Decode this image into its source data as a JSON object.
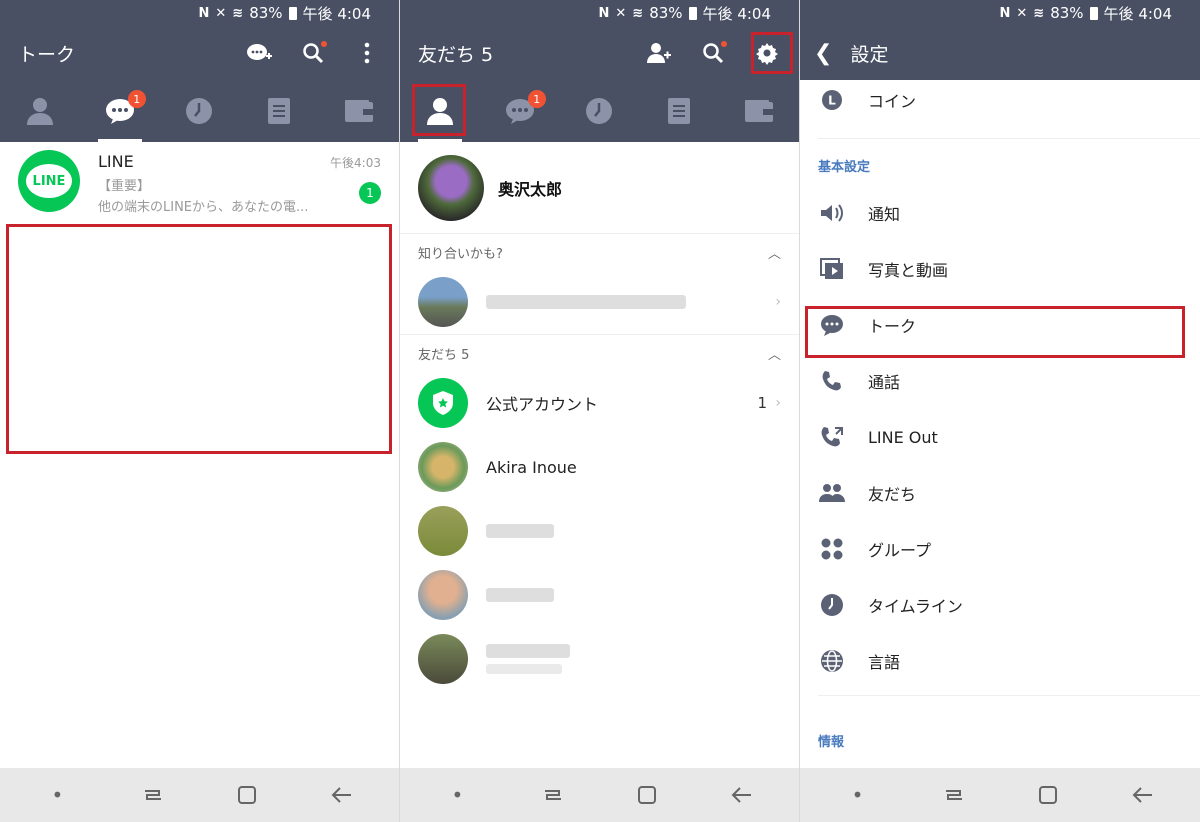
{
  "status": {
    "battery": "83%",
    "time": "午後 4:04"
  },
  "screen1": {
    "title": "トーク",
    "chat": {
      "name": "LINE",
      "time": "午後4:03",
      "line1": "【重要】",
      "line2": "他の端末のLINEから、あなたの電...",
      "count": "1",
      "logo_text": "LINE"
    },
    "tab_badge": "1"
  },
  "screen2": {
    "title": "友だち 5",
    "profile_name": "奥沢太郎",
    "section_suggest": "知り合いかも?",
    "section_friends": "友だち 5",
    "official": {
      "name": "公式アカウント",
      "count": "1"
    },
    "friend_akira": "Akira Inoue",
    "tab_badge": "1"
  },
  "screen3": {
    "title": "設定",
    "coin": "コイン",
    "section_basic": "基本設定",
    "items": [
      "通知",
      "写真と動画",
      "トーク",
      "通話",
      "LINE Out",
      "友だち",
      "グループ",
      "タイムライン",
      "言語"
    ],
    "section_info": "情報"
  },
  "colors": {
    "header": "#4a5064",
    "line_green": "#06c755",
    "badge_red": "#f25234",
    "highlight": "#c8232c",
    "section_blue": "#4a7bbf"
  }
}
